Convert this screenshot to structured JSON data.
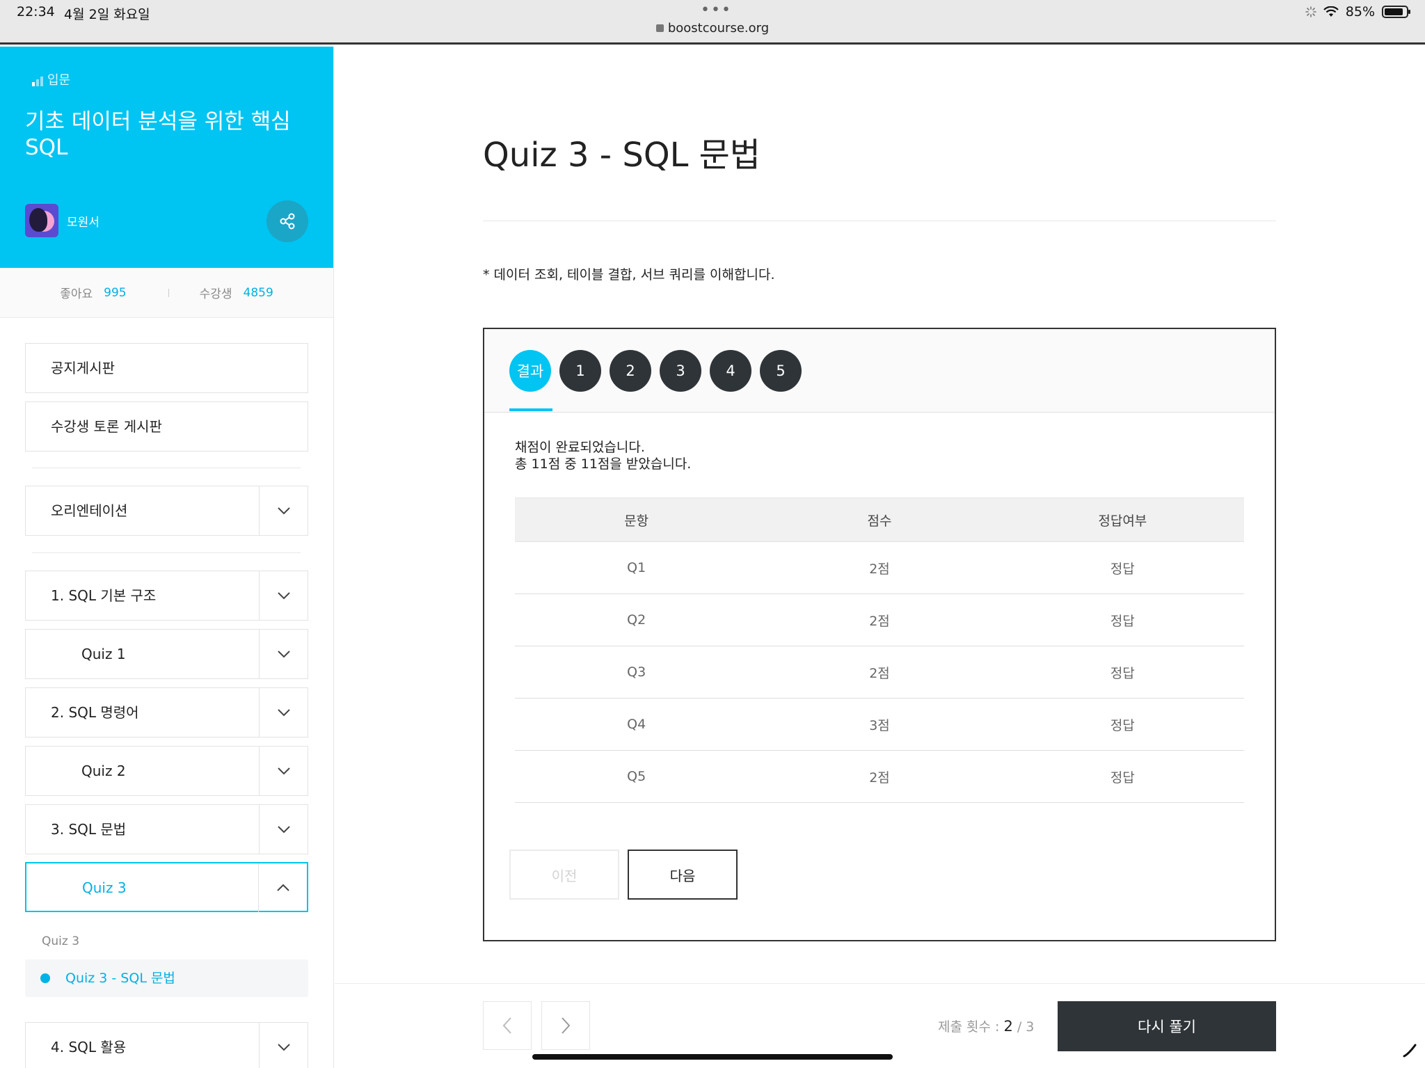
{
  "status_bar": {
    "time": "22:34",
    "date": "4월 2일 화요일",
    "url": "boostcourse.org",
    "battery": "85%"
  },
  "course": {
    "level": "입문",
    "title": "기초 데이터 분석을 위한 핵심 SQL",
    "author": "모원서",
    "likes_label": "좋아요",
    "likes": "995",
    "students_label": "수강생",
    "students": "4859"
  },
  "sidebar": {
    "boards": [
      "공지게시판",
      "수강생 토론 게시판"
    ],
    "orientation": "오리엔테이션",
    "sections": [
      {
        "label": "1. SQL 기본 구조"
      },
      {
        "label": "Quiz 1"
      },
      {
        "label": "2. SQL 명령어"
      },
      {
        "label": "Quiz 2"
      },
      {
        "label": "3. SQL 문법"
      },
      {
        "label": "Quiz 3"
      }
    ],
    "sub_caption": "Quiz 3",
    "sub_item": "Quiz 3 - SQL 문법",
    "next_section": "4. SQL 활용"
  },
  "main": {
    "title": "Quiz 3 - SQL 문법",
    "description": "* 데이터 조회, 테이블 결합, 서브 쿼리를 이해합니다.",
    "tabs": [
      "결과",
      "1",
      "2",
      "3",
      "4",
      "5"
    ],
    "result_line1": "채점이 완료되었습니다.",
    "result_line2": "총 11점 중 11점을 받았습니다.",
    "table": {
      "headers": [
        "문항",
        "점수",
        "정답여부"
      ],
      "rows": [
        [
          "Q1",
          "2점",
          "정답"
        ],
        [
          "Q2",
          "2점",
          "정답"
        ],
        [
          "Q3",
          "2점",
          "정답"
        ],
        [
          "Q4",
          "3점",
          "정답"
        ],
        [
          "Q5",
          "2점",
          "정답"
        ]
      ]
    },
    "prev_label": "이전",
    "next_label": "다음"
  },
  "footer": {
    "submit_label": "제출 횟수 : ",
    "submit_current": "2",
    "submit_total": " / 3",
    "retry_label": "다시 풀기"
  },
  "colors": {
    "accent": "#00c4f2",
    "dark": "#2f3438"
  }
}
